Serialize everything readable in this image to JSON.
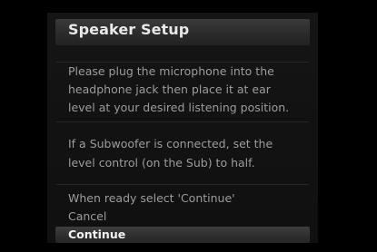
{
  "dialog": {
    "title": "Speaker Setup",
    "paragraph1": [
      "Please plug the microphone into the",
      "headphone jack then place it at ear",
      "level at your desired listening position."
    ],
    "paragraph2": [
      "If a Subwoofer is connected, set the",
      "level control (on the Sub) to half."
    ],
    "prompt": "When ready select 'Continue'",
    "menu": [
      {
        "label": "Cancel",
        "selected": false
      },
      {
        "label": "Continue",
        "selected": true
      }
    ]
  }
}
